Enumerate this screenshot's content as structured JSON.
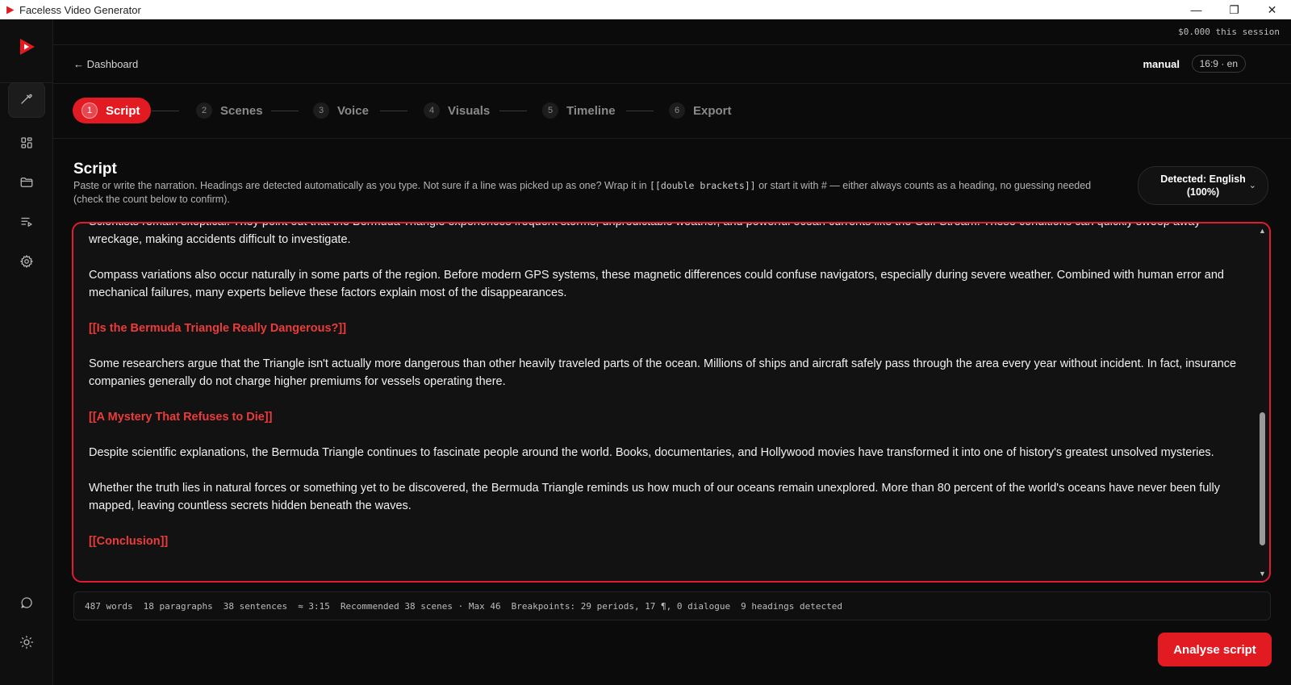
{
  "window": {
    "title": "Faceless Video Generator",
    "controls": [
      "—",
      "❐",
      "✕"
    ]
  },
  "session": {
    "cost": "$0.000 this session"
  },
  "header": {
    "back_label": "← Dashboard",
    "mode": "manual",
    "format": "16:9 · en"
  },
  "sidebar": {
    "items": [
      {
        "icon": "wand-icon",
        "active": true
      },
      {
        "icon": "grid-icon",
        "active": false
      },
      {
        "icon": "folder-icon",
        "active": false
      },
      {
        "icon": "playlist-icon",
        "active": false
      },
      {
        "icon": "gear-icon",
        "active": false
      },
      {
        "icon": "chat-icon",
        "active": false
      },
      {
        "icon": "sun-icon",
        "active": false
      }
    ]
  },
  "steps": [
    {
      "num": "1",
      "label": "Script",
      "active": true
    },
    {
      "num": "2",
      "label": "Scenes",
      "active": false
    },
    {
      "num": "3",
      "label": "Voice",
      "active": false
    },
    {
      "num": "4",
      "label": "Visuals",
      "active": false
    },
    {
      "num": "5",
      "label": "Timeline",
      "active": false
    },
    {
      "num": "6",
      "label": "Export",
      "active": false
    }
  ],
  "script_section": {
    "title": "Script",
    "desc_before": "Paste or write the narration. Headings are detected automatically as you type. Not sure if a line was picked up as one? Wrap it in ",
    "desc_code": "[[double brackets]]",
    "desc_after": " or start it with # — either always counts as a heading, no guessing needed (check the count below to confirm).",
    "language": "Detected: English (100%)"
  },
  "editor": {
    "paragraphs": [
      {
        "heading": false,
        "text": "Scientists remain skeptical. They point out that the Bermuda Triangle experiences frequent storms, unpredictable weather, and powerful ocean currents like the Gulf Stream. These conditions can quickly sweep away wreckage, making accidents difficult to investigate."
      },
      {
        "heading": false,
        "text": "Compass variations also occur naturally in some parts of the region. Before modern GPS systems, these magnetic differences could confuse navigators, especially during severe weather. Combined with human error and mechanical failures, many experts believe these factors explain most of the disappearances."
      },
      {
        "heading": true,
        "text": "[[Is the Bermuda Triangle Really Dangerous?]]"
      },
      {
        "heading": false,
        "text": "Some researchers argue that the Triangle isn't actually more dangerous than other heavily traveled parts of the ocean. Millions of ships and aircraft safely pass through the area every year without incident. In fact, insurance companies generally do not charge higher premiums for vessels operating there."
      },
      {
        "heading": true,
        "text": "[[A Mystery That Refuses to Die]]"
      },
      {
        "heading": false,
        "text": "Despite scientific explanations, the Bermuda Triangle continues to fascinate people around the world. Books, documentaries, and Hollywood movies have transformed it into one of history's greatest unsolved mysteries."
      },
      {
        "heading": false,
        "text": "Whether the truth lies in natural forces or something yet to be discovered, the Bermuda Triangle reminds us how much of our oceans remain unexplored. More than 80 percent of the world's oceans have never been fully mapped, leaving countless secrets hidden beneath the waves."
      },
      {
        "heading": true,
        "text": "[[Conclusion]]"
      }
    ]
  },
  "stats": {
    "words": "487 words",
    "paragraphs": "18 paragraphs",
    "sentences": "38 sentences",
    "duration": "≈ 3:15",
    "recommended": "Recommended 38 scenes · Max 46",
    "breakpoints": "Breakpoints: 29 periods, 17 ¶, 0 dialogue",
    "headings": "9 headings detected"
  },
  "actions": {
    "analyse": "Analyse script"
  },
  "colors": {
    "accent": "#e21b23",
    "heading": "#ec3b3b",
    "background": "#0b0b0b"
  }
}
